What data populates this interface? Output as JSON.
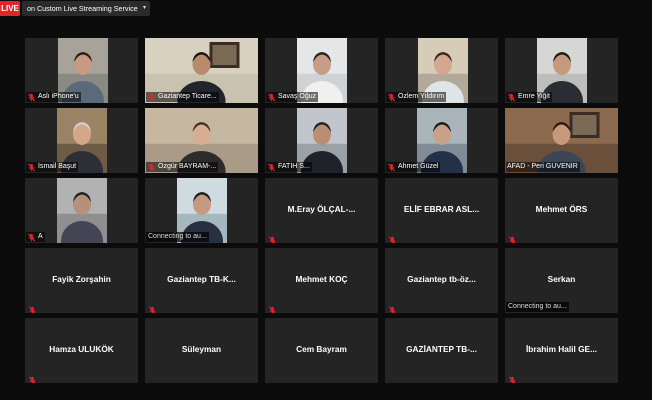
{
  "topbar": {
    "live_label": "LIVE",
    "stream_label": "on Custom Live Streaming Service",
    "caret": "▾"
  },
  "colors": {
    "background": "#0b0b0b",
    "tile": "#242424",
    "live": "#e0262b",
    "active_speaker_border": "#c3d34a",
    "muted_icon": "#e0262b"
  },
  "participants": [
    {
      "name": "Aslı iPhone'u",
      "video": true,
      "muted": true
    },
    {
      "name": "Gaziantep Ticare...",
      "video": true,
      "muted": true
    },
    {
      "name": "Savaş Oğuz",
      "video": true,
      "muted": true
    },
    {
      "name": "Özlem Yıldırım",
      "video": true,
      "muted": true
    },
    {
      "name": "Emre Yiğit",
      "video": true,
      "muted": true
    },
    {
      "name": "İsmail Başut",
      "video": true,
      "muted": true
    },
    {
      "name": "Özgür BAYRAM-...",
      "video": true,
      "muted": true
    },
    {
      "name": "FATİH S...",
      "video": true,
      "muted": true
    },
    {
      "name": "Ahmet Güzel",
      "video": true,
      "muted": true
    },
    {
      "name": "AFAD - Peri GÜVENİR",
      "video": true,
      "muted": false,
      "active": true
    },
    {
      "name": "A",
      "video": true,
      "muted": true
    },
    {
      "name": "",
      "video": true,
      "muted": false,
      "status": "Connecting to au..."
    },
    {
      "name": "M.Eray  ÖLÇAL-...",
      "video": false,
      "muted": true
    },
    {
      "name": "ELİF EBRAR ASL...",
      "video": false,
      "muted": true
    },
    {
      "name": "Mehmet ÖRS",
      "video": false,
      "muted": true
    },
    {
      "name": "Fayik Zorşahin",
      "video": false,
      "muted": true
    },
    {
      "name": "Gaziantep  TB-K...",
      "video": false,
      "muted": true
    },
    {
      "name": "Mehmet KOÇ",
      "video": false,
      "muted": true
    },
    {
      "name": "Gaziantep  tb-öz...",
      "video": false,
      "muted": true
    },
    {
      "name": "Serkan",
      "video": false,
      "muted": false,
      "status": "Connecting to au..."
    },
    {
      "name": "Hamza ULUKÖK",
      "video": false,
      "muted": true
    },
    {
      "name": "Süleyman",
      "video": false,
      "muted": false
    },
    {
      "name": "Cem Bayram",
      "video": false,
      "muted": false
    },
    {
      "name": "GAZİANTEP TB-...",
      "video": false,
      "muted": false
    },
    {
      "name": "İbrahim  Halil  GE...",
      "video": false,
      "muted": true
    }
  ]
}
